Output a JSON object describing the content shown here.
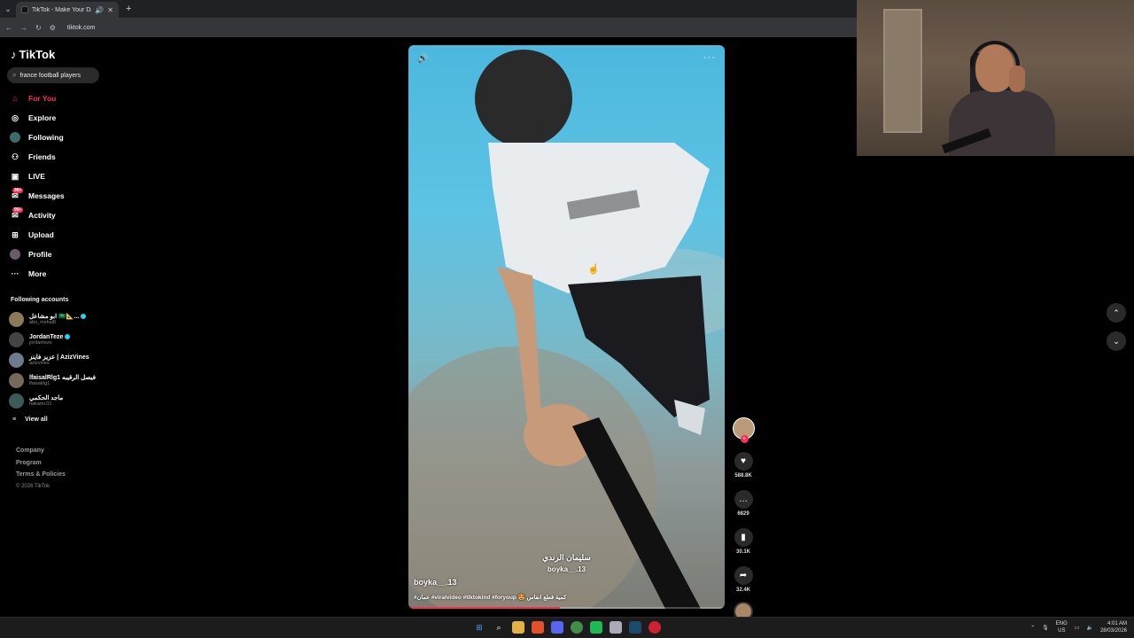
{
  "browser": {
    "tab_title": "TikTok - Make Your Day",
    "url": "tiktok.com"
  },
  "sidebar": {
    "logo": "TikTok",
    "search_value": "france football players",
    "nav": [
      {
        "label": "For You",
        "icon": "home-icon",
        "active": true
      },
      {
        "label": "Explore",
        "icon": "compass-icon"
      },
      {
        "label": "Following",
        "icon": "following-avatar-icon"
      },
      {
        "label": "Friends",
        "icon": "friends-icon"
      },
      {
        "label": "LIVE",
        "icon": "live-icon"
      },
      {
        "label": "Messages",
        "icon": "messages-icon",
        "badge": "99+"
      },
      {
        "label": "Activity",
        "icon": "activity-icon",
        "badge": "99+"
      },
      {
        "label": "Upload",
        "icon": "upload-icon"
      },
      {
        "label": "Profile",
        "icon": "profile-avatar-icon"
      },
      {
        "label": "More",
        "icon": "more-icon"
      }
    ],
    "following_title": "Following accounts",
    "following": [
      {
        "name": "ابو مشاعل 🇸🇦📐...",
        "user": "abo_mshal8",
        "verified": true
      },
      {
        "name": "JordanTeze",
        "user": "jordanteze",
        "verified": true
      },
      {
        "name": "عزيز فاينز | AzizVines",
        "user": "azizvines",
        "verified": false
      },
      {
        "name": "lfaisalRlg1 فيصل الرقيبه",
        "user": "lfaisalrlg1",
        "verified": false
      },
      {
        "name": "ماجد الحكمي",
        "user": "hakami.01",
        "verified": false
      }
    ],
    "view_all": "View all",
    "footer": [
      "Company",
      "Program",
      "Terms & Policies"
    ],
    "copyright": "© 2026 TikTok"
  },
  "video": {
    "caption_arabic": "سليمان الرندي",
    "caption_user": "boyka__.13",
    "author": "boyka__.13",
    "description": "#عمان #viralvideo #tiktokind #foryoup 😍 كمية قطع انفاس",
    "progress": 0.48
  },
  "actions": {
    "likes": "588.8K",
    "comments": "6829",
    "saves": "30.1K",
    "shares": "32.4K"
  },
  "taskbar": {
    "lang_top": "ENG",
    "lang_bottom": "US",
    "time": "4:01 AM",
    "date": "28/03/2026"
  }
}
